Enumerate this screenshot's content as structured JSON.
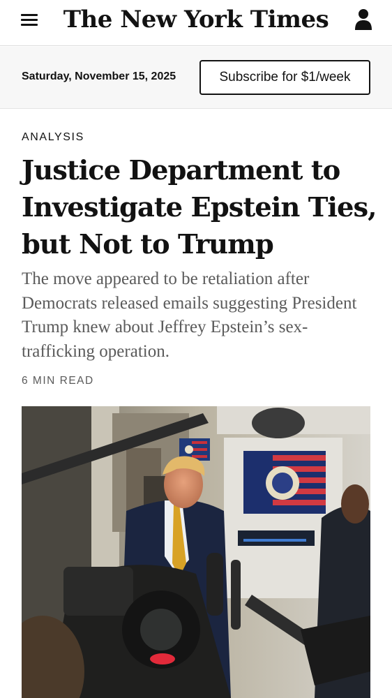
{
  "header": {
    "logo": "The New York Times",
    "menu_icon": "hamburger-menu-icon",
    "account_icon": "user-account-icon"
  },
  "date_bar": {
    "date": "Saturday, November 15, 2025",
    "subscribe_label": "Subscribe for $1/week"
  },
  "article": {
    "kicker": "ANALYSIS",
    "headline": "Justice Department to Investigate Epstein Ties, but Not to Trump",
    "summary": "The move appeared to be retaliation after Democrats released emails suggesting President Trump knew about Jeffrey Epstein’s sex-trafficking operation.",
    "read_time": "6 MIN READ"
  },
  "colors": {
    "text": "#121212",
    "secondary_text": "#5a5a5a",
    "date_bar_bg": "#f7f7f7",
    "divider": "#dcdcdc"
  }
}
